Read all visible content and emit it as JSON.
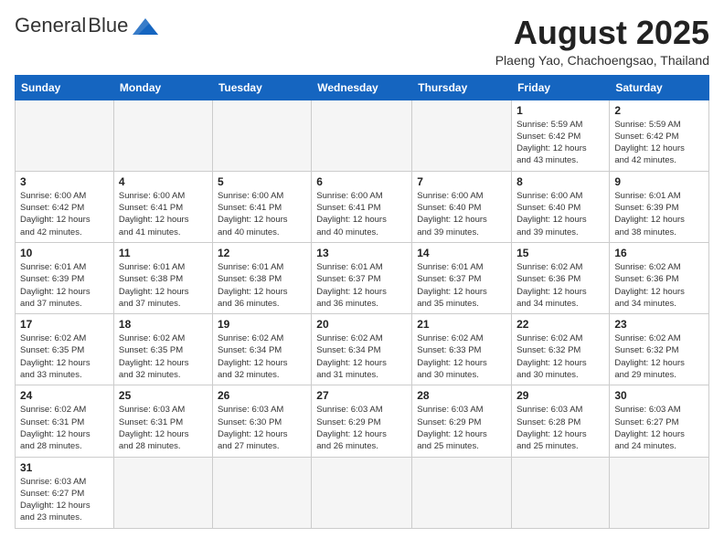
{
  "header": {
    "logo_general": "General",
    "logo_blue": "Blue",
    "month_title": "August 2025",
    "subtitle": "Plaeng Yao, Chachoengsao, Thailand"
  },
  "weekdays": [
    "Sunday",
    "Monday",
    "Tuesday",
    "Wednesday",
    "Thursday",
    "Friday",
    "Saturday"
  ],
  "weeks": [
    [
      {
        "day": "",
        "empty": true
      },
      {
        "day": "",
        "empty": true
      },
      {
        "day": "",
        "empty": true
      },
      {
        "day": "",
        "empty": true
      },
      {
        "day": "",
        "empty": true
      },
      {
        "day": "1",
        "sunrise": "5:59 AM",
        "sunset": "6:42 PM",
        "daylight": "12 hours and 43 minutes."
      },
      {
        "day": "2",
        "sunrise": "5:59 AM",
        "sunset": "6:42 PM",
        "daylight": "12 hours and 42 minutes."
      }
    ],
    [
      {
        "day": "3",
        "sunrise": "6:00 AM",
        "sunset": "6:42 PM",
        "daylight": "12 hours and 42 minutes."
      },
      {
        "day": "4",
        "sunrise": "6:00 AM",
        "sunset": "6:41 PM",
        "daylight": "12 hours and 41 minutes."
      },
      {
        "day": "5",
        "sunrise": "6:00 AM",
        "sunset": "6:41 PM",
        "daylight": "12 hours and 40 minutes."
      },
      {
        "day": "6",
        "sunrise": "6:00 AM",
        "sunset": "6:41 PM",
        "daylight": "12 hours and 40 minutes."
      },
      {
        "day": "7",
        "sunrise": "6:00 AM",
        "sunset": "6:40 PM",
        "daylight": "12 hours and 39 minutes."
      },
      {
        "day": "8",
        "sunrise": "6:00 AM",
        "sunset": "6:40 PM",
        "daylight": "12 hours and 39 minutes."
      },
      {
        "day": "9",
        "sunrise": "6:01 AM",
        "sunset": "6:39 PM",
        "daylight": "12 hours and 38 minutes."
      }
    ],
    [
      {
        "day": "10",
        "sunrise": "6:01 AM",
        "sunset": "6:39 PM",
        "daylight": "12 hours and 37 minutes."
      },
      {
        "day": "11",
        "sunrise": "6:01 AM",
        "sunset": "6:38 PM",
        "daylight": "12 hours and 37 minutes."
      },
      {
        "day": "12",
        "sunrise": "6:01 AM",
        "sunset": "6:38 PM",
        "daylight": "12 hours and 36 minutes."
      },
      {
        "day": "13",
        "sunrise": "6:01 AM",
        "sunset": "6:37 PM",
        "daylight": "12 hours and 36 minutes."
      },
      {
        "day": "14",
        "sunrise": "6:01 AM",
        "sunset": "6:37 PM",
        "daylight": "12 hours and 35 minutes."
      },
      {
        "day": "15",
        "sunrise": "6:02 AM",
        "sunset": "6:36 PM",
        "daylight": "12 hours and 34 minutes."
      },
      {
        "day": "16",
        "sunrise": "6:02 AM",
        "sunset": "6:36 PM",
        "daylight": "12 hours and 34 minutes."
      }
    ],
    [
      {
        "day": "17",
        "sunrise": "6:02 AM",
        "sunset": "6:35 PM",
        "daylight": "12 hours and 33 minutes."
      },
      {
        "day": "18",
        "sunrise": "6:02 AM",
        "sunset": "6:35 PM",
        "daylight": "12 hours and 32 minutes."
      },
      {
        "day": "19",
        "sunrise": "6:02 AM",
        "sunset": "6:34 PM",
        "daylight": "12 hours and 32 minutes."
      },
      {
        "day": "20",
        "sunrise": "6:02 AM",
        "sunset": "6:34 PM",
        "daylight": "12 hours and 31 minutes."
      },
      {
        "day": "21",
        "sunrise": "6:02 AM",
        "sunset": "6:33 PM",
        "daylight": "12 hours and 30 minutes."
      },
      {
        "day": "22",
        "sunrise": "6:02 AM",
        "sunset": "6:32 PM",
        "daylight": "12 hours and 30 minutes."
      },
      {
        "day": "23",
        "sunrise": "6:02 AM",
        "sunset": "6:32 PM",
        "daylight": "12 hours and 29 minutes."
      }
    ],
    [
      {
        "day": "24",
        "sunrise": "6:02 AM",
        "sunset": "6:31 PM",
        "daylight": "12 hours and 28 minutes."
      },
      {
        "day": "25",
        "sunrise": "6:03 AM",
        "sunset": "6:31 PM",
        "daylight": "12 hours and 28 minutes."
      },
      {
        "day": "26",
        "sunrise": "6:03 AM",
        "sunset": "6:30 PM",
        "daylight": "12 hours and 27 minutes."
      },
      {
        "day": "27",
        "sunrise": "6:03 AM",
        "sunset": "6:29 PM",
        "daylight": "12 hours and 26 minutes."
      },
      {
        "day": "28",
        "sunrise": "6:03 AM",
        "sunset": "6:29 PM",
        "daylight": "12 hours and 25 minutes."
      },
      {
        "day": "29",
        "sunrise": "6:03 AM",
        "sunset": "6:28 PM",
        "daylight": "12 hours and 25 minutes."
      },
      {
        "day": "30",
        "sunrise": "6:03 AM",
        "sunset": "6:27 PM",
        "daylight": "12 hours and 24 minutes."
      }
    ],
    [
      {
        "day": "31",
        "sunrise": "6:03 AM",
        "sunset": "6:27 PM",
        "daylight": "12 hours and 23 minutes."
      },
      {
        "day": "",
        "empty": true
      },
      {
        "day": "",
        "empty": true
      },
      {
        "day": "",
        "empty": true
      },
      {
        "day": "",
        "empty": true
      },
      {
        "day": "",
        "empty": true
      },
      {
        "day": "",
        "empty": true
      }
    ]
  ],
  "labels": {
    "sunrise": "Sunrise:",
    "sunset": "Sunset:",
    "daylight": "Daylight:"
  }
}
